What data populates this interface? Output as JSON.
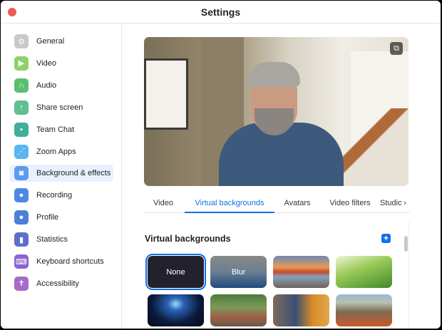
{
  "window": {
    "title": "Settings"
  },
  "sidebar": {
    "items": [
      {
        "label": "General",
        "icon": "gear-icon",
        "color": "#c9c9c9"
      },
      {
        "label": "Video",
        "icon": "video-camera-icon",
        "color": "#8fd16a"
      },
      {
        "label": "Audio",
        "icon": "headphones-icon",
        "color": "#5cbf6e"
      },
      {
        "label": "Share screen",
        "icon": "share-screen-icon",
        "color": "#5fbf8f"
      },
      {
        "label": "Team Chat",
        "icon": "chat-bubbles-icon",
        "color": "#3fae9a"
      },
      {
        "label": "Zoom Apps",
        "icon": "apps-icon",
        "color": "#5ab6f0"
      },
      {
        "label": "Background & effects",
        "icon": "background-portrait-icon",
        "color": "#5a9cf0",
        "active": true
      },
      {
        "label": "Recording",
        "icon": "record-icon",
        "color": "#4f86e8"
      },
      {
        "label": "Profile",
        "icon": "person-icon",
        "color": "#4e7fd8"
      },
      {
        "label": "Statistics",
        "icon": "bar-chart-icon",
        "color": "#5b6fcc"
      },
      {
        "label": "Keyboard shortcuts",
        "icon": "keyboard-icon",
        "color": "#8a63d2"
      },
      {
        "label": "Accessibility",
        "icon": "accessibility-icon",
        "color": "#a86ac9"
      }
    ]
  },
  "tabs": [
    {
      "label": "Video"
    },
    {
      "label": "Virtual backgrounds",
      "active": true
    },
    {
      "label": "Avatars"
    },
    {
      "label": "Video filters"
    },
    {
      "label": "Studio"
    }
  ],
  "tabs_more_icon": "chevron-right-icon",
  "section": {
    "title": "Virtual backgrounds",
    "add_icon": "plus-icon"
  },
  "backgrounds": [
    {
      "label": "None"
    },
    {
      "label": "Blur"
    },
    {
      "label": ""
    },
    {
      "label": ""
    },
    {
      "label": ""
    },
    {
      "label": ""
    },
    {
      "label": ""
    },
    {
      "label": ""
    }
  ],
  "accent": "#0e71eb"
}
